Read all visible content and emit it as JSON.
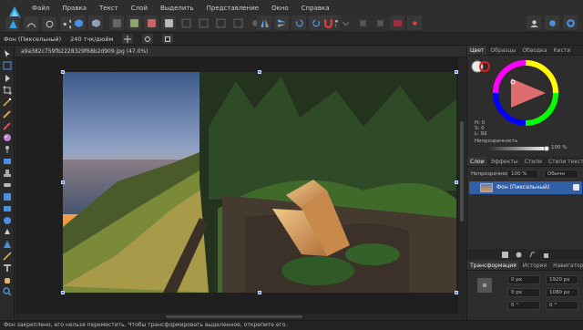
{
  "app": {
    "name": "Affinity Photo"
  },
  "menu": [
    "Файл",
    "Правка",
    "Текст",
    "Слой",
    "Выделить",
    "Представление",
    "Окно",
    "Справка"
  ],
  "context": {
    "layer_label": "Фон (Пиксельный)",
    "dpi_label": "240 тчк/дюйм"
  },
  "document": {
    "tab_title": "a9a382c759fb2228329f68b2d909.jpg (47.0%)"
  },
  "status": {
    "text": "Фон закреплено, его нельзя переместить. Чтобы трансформировать выделенное, открепите его."
  },
  "color_panel": {
    "tabs": [
      "Цвет",
      "Образцы",
      "Обводка",
      "Кисти"
    ],
    "active_tab": "Цвет",
    "hsl": {
      "h": "H: 0",
      "s": "S: 0",
      "l": "L: 92"
    },
    "opacity_label": "Непрозрачность",
    "opacity_value": "100 %",
    "opacity_level": 1.0
  },
  "layers_panel": {
    "tabs": [
      "Слои",
      "Эффекты",
      "Стили",
      "Стили текста"
    ],
    "active_tab": "Слои",
    "opacity_label": "Непрозрачность:",
    "opacity_value": "100 %",
    "blend_mode": "Обычн",
    "layer_name": "Фон (Пиксельный)"
  },
  "transform_panel": {
    "tabs": [
      "Трансформация",
      "История",
      "Навигатор"
    ],
    "active_tab": "Трансформация",
    "fields": [
      "0 px",
      "1920 px",
      "0 px",
      "1080 px",
      "0 °",
      "0 °"
    ]
  },
  "colors": {
    "accent": "#3c82f0",
    "selection": "#3060a8"
  }
}
